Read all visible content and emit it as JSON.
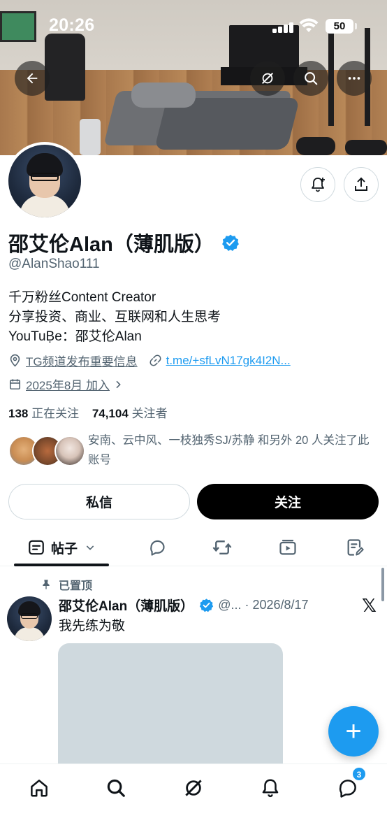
{
  "status_bar": {
    "time": "20:26",
    "battery": "50"
  },
  "profile": {
    "name": "邵艾伦Alan（薄肌版）",
    "handle": "@AlanShao111",
    "bio_lines": [
      "千万粉丝Content Creator",
      "分享投资、商业、互联网和人生思考",
      "YouTuḄe：邵艾伦Alan"
    ],
    "location": "TG频道发布重要信息",
    "website": "t.me/+sfLvN17gk4I2N...",
    "joined": "2025年8月 加入",
    "following_count": "138",
    "following_label": "正在关注",
    "followers_count": "74,104",
    "followers_label": "关注者",
    "followed_by": "安南、云中风、一枝独秀SJ/苏静 和另外 20 人关注了此账号"
  },
  "buttons": {
    "message": "私信",
    "follow": "关注"
  },
  "tabs": {
    "active_label": "帖子"
  },
  "post": {
    "pinned_label": "已置顶",
    "author": "邵艾伦Alan（薄肌版）",
    "meta": "@... · 2026/8/17",
    "text": "我先练为敬"
  },
  "fab": {
    "label": "+"
  },
  "nav": {
    "messages_badge": "3"
  },
  "colors": {
    "accent": "#1d9bf0",
    "text": "#0f1419",
    "muted": "#536471",
    "border": "#cfd9de"
  }
}
